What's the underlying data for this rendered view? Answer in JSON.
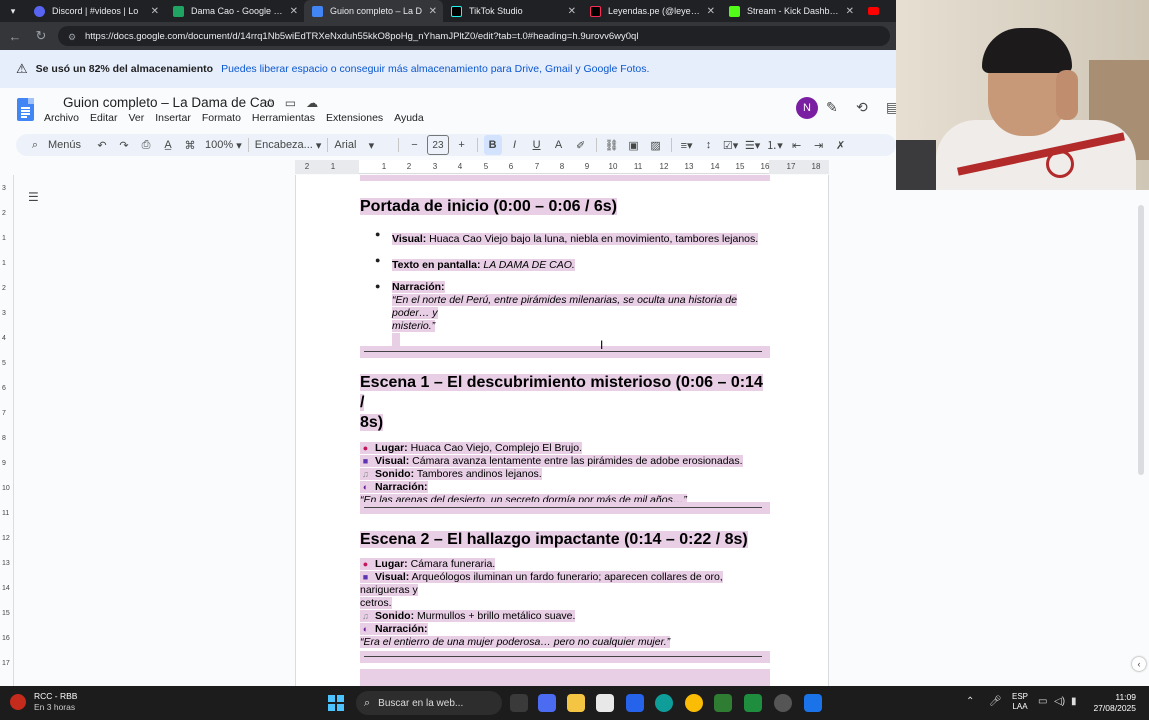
{
  "tabs": [
    {
      "label": "Discord | #videos | Lo",
      "color": "#5865f2"
    },
    {
      "label": "Dama Cao - Google Drive",
      "color": "#1fa463"
    },
    {
      "label": "Guion completo – La D",
      "color": "#4285f4"
    },
    {
      "label": "TikTok Studio",
      "color": "#000000"
    },
    {
      "label": "Leyendas.pe (@leyendas.pe",
      "color": "#000000"
    },
    {
      "label": "Stream - Kick Dashboard",
      "color": "#53fc18"
    }
  ],
  "address": {
    "url": "https://docs.google.com/document/d/14rrq1Nb5wiEdTRXeNxduh55kkO8poHg_nYhamJPltZ0/edit?tab=t.0#heading=h.9urovv6wy0ql"
  },
  "storage": {
    "bold": "Se usó un 82% del almacenamiento",
    "link": "Puedes liberar espacio o conseguir más almacenamiento para Drive, Gmail y Google Fotos."
  },
  "doc": {
    "title": "Guion completo – La Dama de Cao",
    "avatar": "N",
    "menus": [
      "Archivo",
      "Editar",
      "Ver",
      "Insertar",
      "Formato",
      "Herramientas",
      "Extensiones",
      "Ayuda"
    ]
  },
  "toolbar": {
    "menus": "Menús",
    "zoom": "100%",
    "style": "Encabeza...",
    "font": "Arial",
    "size": "23"
  },
  "ruler": [
    "2",
    "1",
    "1",
    "2",
    "3",
    "4",
    "5",
    "6",
    "7",
    "8",
    "9",
    "10",
    "11",
    "12",
    "13",
    "14",
    "15",
    "16",
    "17",
    "18"
  ],
  "vruler": [
    "3",
    "2",
    "1",
    "1",
    "2",
    "3",
    "4",
    "5",
    "6",
    "7",
    "8",
    "9",
    "10",
    "11",
    "12",
    "13",
    "14",
    "15",
    "16",
    "17"
  ],
  "content": {
    "s0": {
      "heading": "Portada de inicio (0:00 – 0:06 / 6s)",
      "visual_label": "Visual:",
      "visual": "Huaca Cao Viejo bajo la luna, niebla en movimiento, tambores lejanos.",
      "texto_label": "Texto en pantalla:",
      "texto": "LA DAMA DE CAO.",
      "narr_label": "Narración:",
      "narr1": "“En el norte del Perú, entre pirámides milenarias, se oculta una historia de poder… y",
      "narr2": "misterio.”"
    },
    "s1": {
      "heading1": "Escena 1 – El descubrimiento misterioso (0:06 – 0:14 /",
      "heading2": "8s)",
      "lugar_label": "Lugar:",
      "lugar": "Huaca Cao Viejo, Complejo El Brujo.",
      "visual_label": "Visual:",
      "visual": "Cámara avanza lentamente entre las pirámides de adobe erosionadas.",
      "sonido_label": "Sonido:",
      "sonido": "Tambores andinos lejanos.",
      "narr_label": "Narración:",
      "narr": "“En las arenas del desierto, un secreto dormía por más de mil años…”"
    },
    "s2": {
      "heading": "Escena 2 – El hallazgo impactante (0:14 – 0:22 / 8s)",
      "lugar_label": "Lugar:",
      "lugar": "Cámara funeraria.",
      "visual_label": "Visual:",
      "visual1": "Arqueólogos iluminan un fardo funerario; aparecen collares de oro, narigueras y",
      "visual2": "cetros.",
      "sonido_label": "Sonido:",
      "sonido": "Murmullos + brillo metálico suave.",
      "narr_label": "Narración:",
      "narr": "“Era el entierro de una mujer poderosa… pero no cualquier mujer.”"
    }
  },
  "taskbar": {
    "weather1": "RCC - RBB",
    "weather2": "En 3 horas",
    "search": "Buscar en la web...",
    "lang1": "ESP",
    "lang2": "LAA",
    "time": "11:09",
    "date": "27/08/2025"
  }
}
